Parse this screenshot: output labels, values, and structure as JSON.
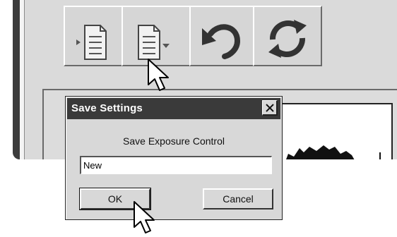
{
  "dialog": {
    "title": "Save Settings",
    "prompt": "Save Exposure Control",
    "name_value": "New",
    "ok_label": "OK",
    "cancel_label": "Cancel"
  },
  "toolbar": {
    "buttons": [
      {
        "icon": "document-arrow-icon"
      },
      {
        "icon": "document-dropdown-icon"
      },
      {
        "icon": "undo-icon"
      },
      {
        "icon": "refresh-icon"
      }
    ]
  },
  "icons": {
    "close": "close-icon",
    "cursor": "mouse-pointer-icon"
  },
  "colors": {
    "title_bar": "#3a3a3a",
    "dialog_bg": "#d8d8d8",
    "panel_bg": "#dadada"
  }
}
